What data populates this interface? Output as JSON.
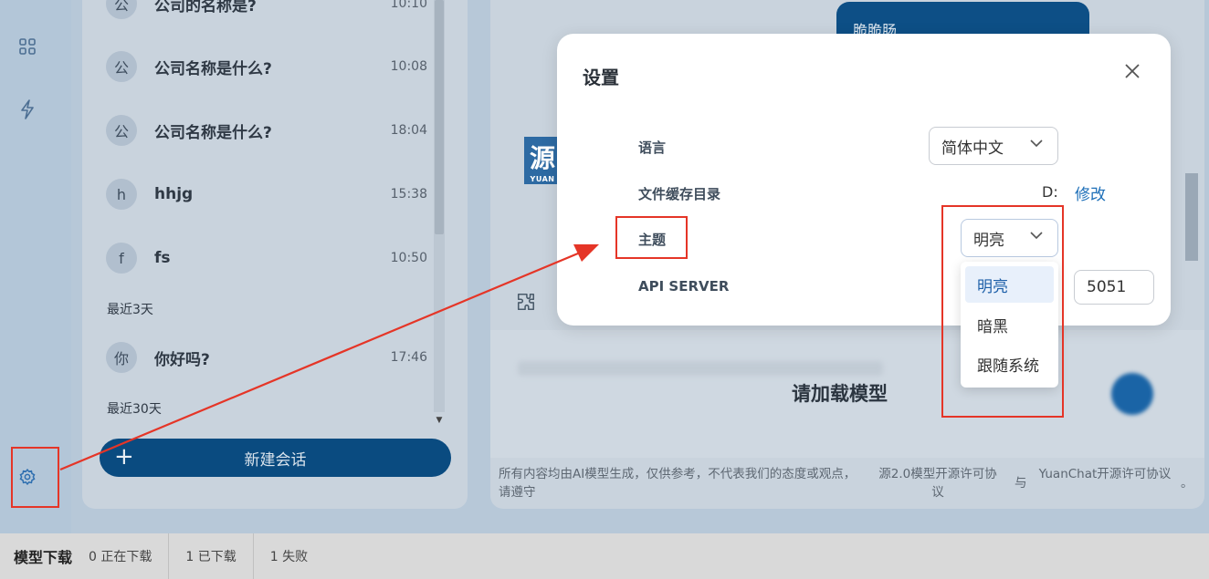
{
  "conversations": [
    {
      "avatar": "公",
      "title": "公司的名称是?",
      "time": "10:10"
    },
    {
      "avatar": "公",
      "title": "公司名称是什么?",
      "time": "10:08"
    },
    {
      "avatar": "公",
      "title": "公司名称是什么?",
      "time": "18:04"
    },
    {
      "avatar": "h",
      "title": "hhjg",
      "time": "15:38"
    },
    {
      "avatar": "f",
      "title": "fs",
      "time": "10:50"
    },
    {
      "avatar": "你",
      "title": "你好吗?",
      "time": "17:46"
    }
  ],
  "groups": {
    "recent3": "最近3天",
    "recent30": "最近30天"
  },
  "new_chat_label": "新建会话",
  "new_chat_plus": "+",
  "chat": {
    "bubble_text": "脆脆肠",
    "logo_char": "源",
    "logo_sub": "YUAN",
    "load_model": "请加载模型",
    "footer_disclaimer": "所有内容均由AI模型生成，仅供参考，不代表我们的态度或观点，请遵守",
    "footer_license1": "源2.0模型开源许可协议",
    "footer_and": "与",
    "footer_license2": "YuanChat开源许可协议",
    "footer_dot": "。"
  },
  "settings": {
    "title": "设置",
    "language_label": "语言",
    "language_value": "简体中文",
    "cache_dir_label": "文件缓存目录",
    "cache_dir_value": "D:",
    "cache_dir_modify": "修改",
    "theme_label": "主题",
    "theme_value": "明亮",
    "theme_options": [
      "明亮",
      "暗黑",
      "跟随系统"
    ],
    "api_server_label": "API SERVER",
    "api_server_port": "5051"
  },
  "statusbar": {
    "title": "模型下载",
    "downloading": "0 正在下载",
    "downloaded": "1 已下载",
    "failed": "1 失败"
  },
  "colors": {
    "accent": "#0a4b80",
    "annotation": "#e53527",
    "link": "#1d6fb8"
  }
}
